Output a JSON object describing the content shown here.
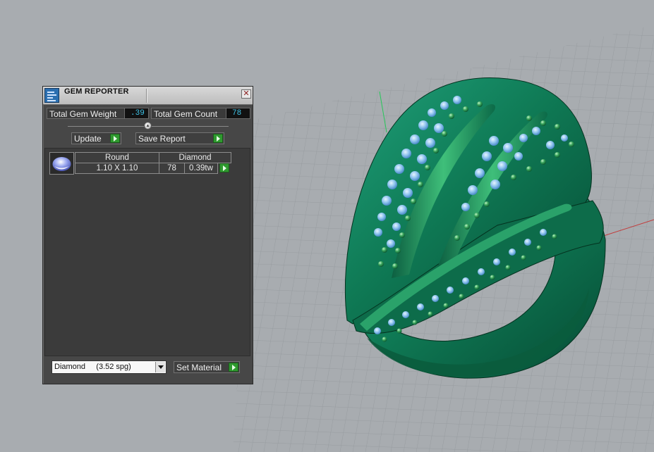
{
  "panel": {
    "title": "GEM REPORTER",
    "close_glyph": "✕",
    "total_gem_weight_label": "Total Gem Weight",
    "total_gem_weight_value": ".39",
    "total_gem_count_label": "Total Gem Count",
    "total_gem_count_value": "78",
    "update_label": "Update",
    "save_report_label": "Save Report",
    "gem_rows": [
      {
        "shape": "Round",
        "material": "Diamond",
        "size": "1.10 X 1.10",
        "count": "78",
        "weight": "0.39tw"
      }
    ],
    "material_select_value": "Diamond     (3.52 spg)",
    "set_material_label": "Set Material"
  },
  "icons": {
    "app": "gem-reporter-icon",
    "close": "close-icon",
    "play": "play-arrow-icon",
    "dropdown": "chevron-down-icon",
    "gem_thumbnail": "round-gem-icon"
  },
  "colors": {
    "viewport_bg": "#a8acb0",
    "grid_line": "#959a9e",
    "panel_bg": "#474747",
    "value_text": "#3fc3e8",
    "ring_green": "#0f7a55",
    "gem_blue": "#8fc4ee",
    "accent_button": "#2f9a2f",
    "axis_red": "#c23b3b",
    "axis_green": "#27c75a"
  }
}
